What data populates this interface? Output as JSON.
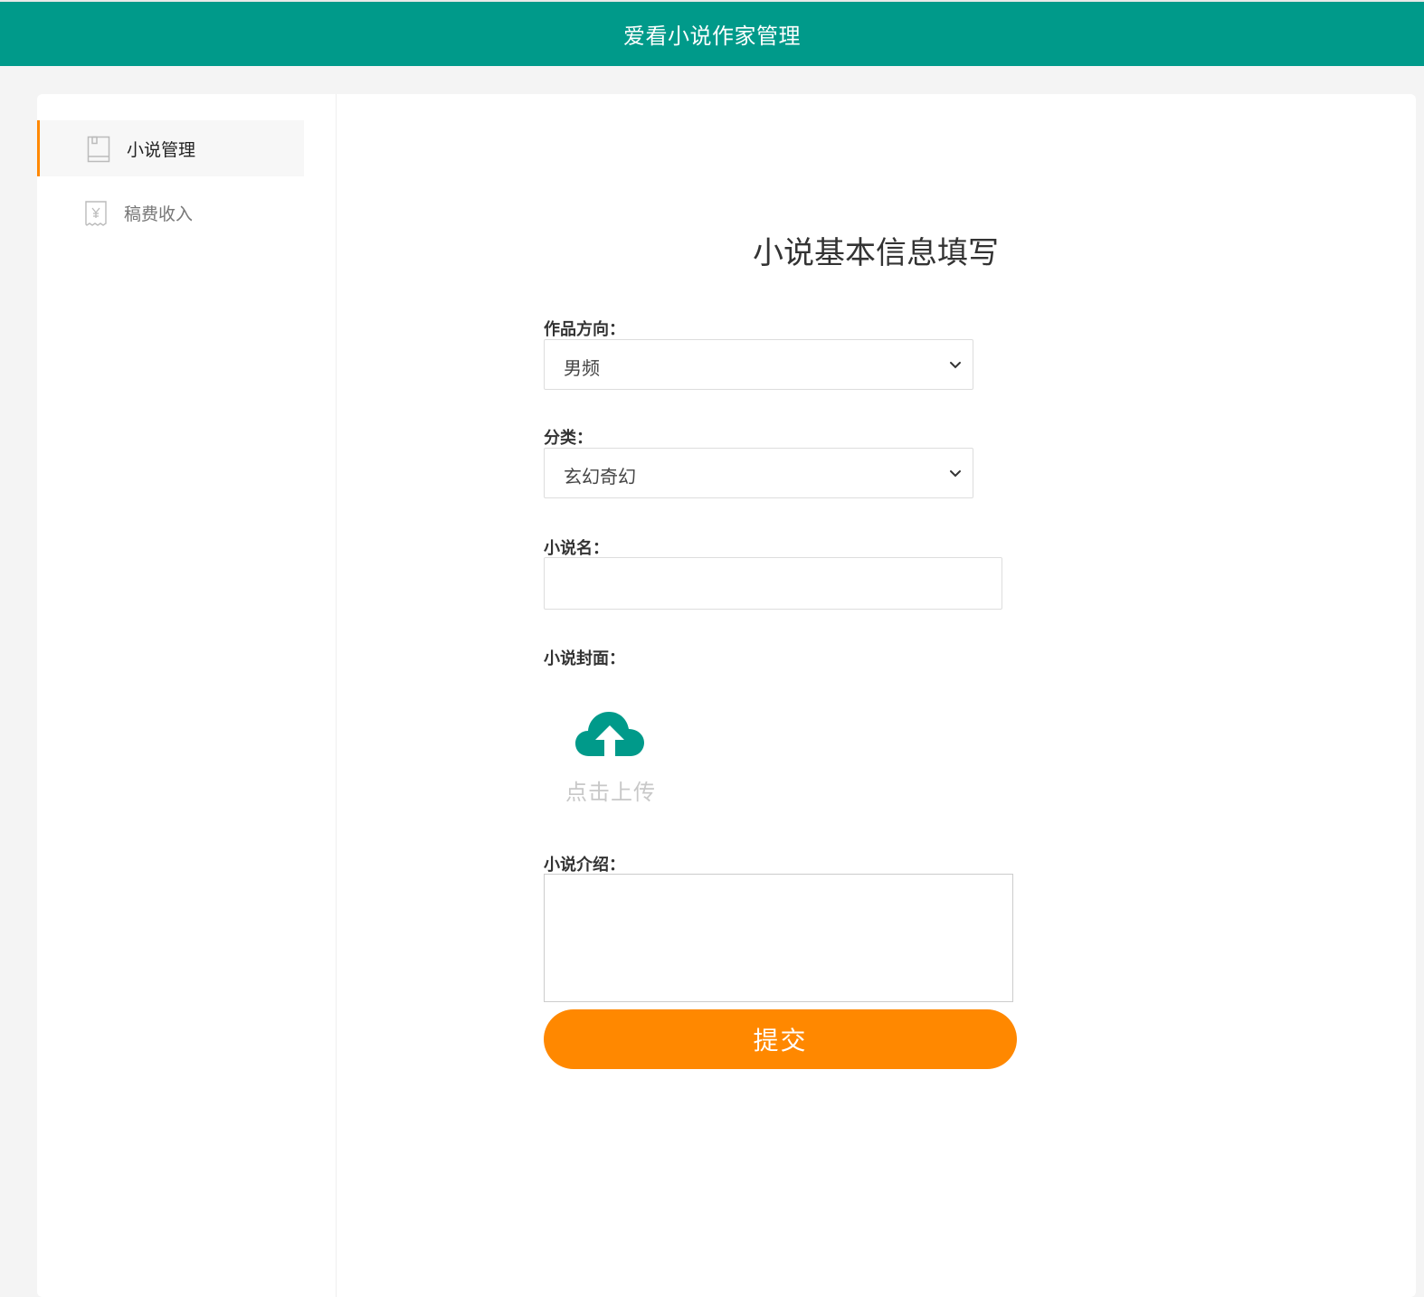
{
  "header": {
    "title": "爱看小说作家管理"
  },
  "sidebar": {
    "items": [
      {
        "label": "小说管理",
        "icon": "book-icon",
        "active": true
      },
      {
        "label": "稿费收入",
        "icon": "receipt-yen-icon",
        "active": false
      }
    ]
  },
  "form": {
    "title": "小说基本信息填写",
    "direction": {
      "label": "作品方向：",
      "value": "男频"
    },
    "category": {
      "label": "分类：",
      "value": "玄幻奇幻"
    },
    "name": {
      "label": "小说名：",
      "value": ""
    },
    "cover": {
      "label": "小说封面：",
      "upload_text": "点击上传",
      "icon": "cloud-upload-icon"
    },
    "intro": {
      "label": "小说介绍：",
      "value": ""
    },
    "submit_label": "提交"
  },
  "colors": {
    "header_bg": "#009a8a",
    "accent": "#ff8800",
    "upload_icon": "#009a8a"
  }
}
